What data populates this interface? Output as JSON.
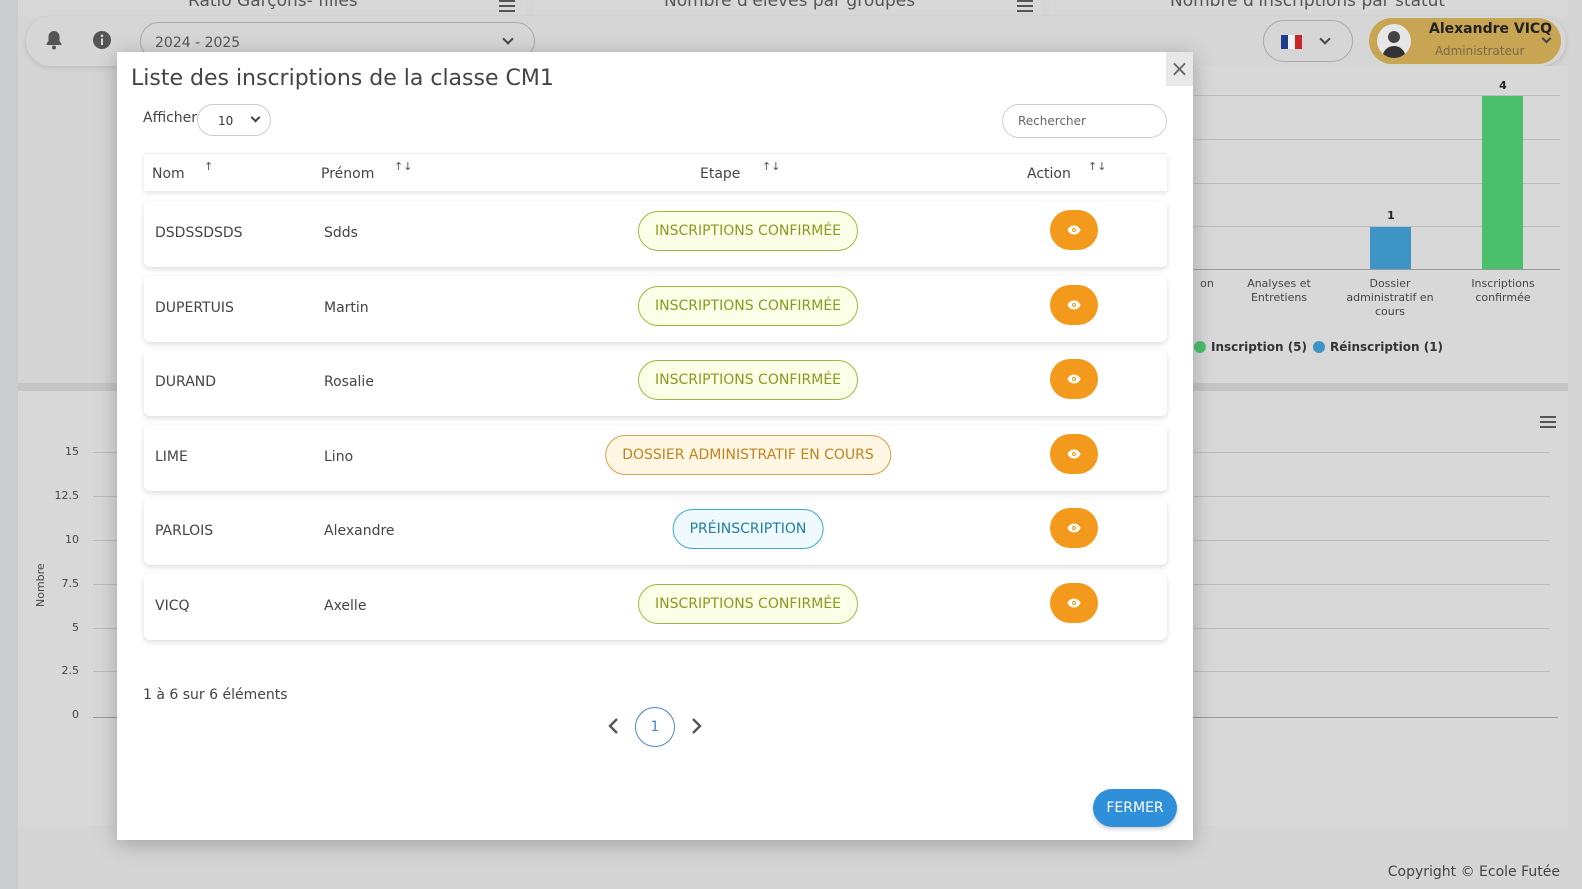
{
  "background": {
    "card_titles": [
      "Ratio Garçons- filles",
      "Nombre d'élèves par groupes",
      "Nombre d'inscriptions par statut"
    ],
    "year_select": "2024 - 2025",
    "user": {
      "name": "Alexandre VICQ",
      "role": "Administrateur"
    },
    "status_chart": {
      "categories": [
        "on",
        "Analyses et Entretiens",
        "Dossier administratif en cours",
        "Inscriptions confirmée"
      ],
      "bar_values": [
        "1",
        "4"
      ],
      "legend": [
        "Inscription (5)",
        "Réinscription (1)"
      ],
      "colors": {
        "inscription": "#4bc06c",
        "reinscription": "#3d95c6"
      }
    },
    "group_chart": {
      "ylabel": "Nombre",
      "yticks": [
        "15",
        "12.5",
        "10",
        "7.5",
        "5",
        "2.5",
        "0"
      ]
    },
    "copyright": "Copyright © Ecole Futée"
  },
  "modal": {
    "title": "Liste des inscriptions de la classe CM1",
    "show_label": "Afficher",
    "page_length": "10",
    "search_placeholder": "Rechercher",
    "columns": [
      "Nom",
      "Prénom",
      "Etape",
      "Action"
    ],
    "rows": [
      {
        "nom": "DSDSSDSDS",
        "prenom": "Sdds",
        "etape": "INSCRIPTIONS CONFIRMÉE",
        "status": "confirmed"
      },
      {
        "nom": "DUPERTUIS",
        "prenom": "Martin",
        "etape": "INSCRIPTIONS CONFIRMÉE",
        "status": "confirmed"
      },
      {
        "nom": "DURAND",
        "prenom": "Rosalie",
        "etape": "INSCRIPTIONS CONFIRMÉE",
        "status": "confirmed"
      },
      {
        "nom": "LIME",
        "prenom": "Lino",
        "etape": "DOSSIER ADMINISTRATIF EN COURS",
        "status": "dossier"
      },
      {
        "nom": "PARLOIS",
        "prenom": "Alexandre",
        "etape": "PRÉINSCRIPTION",
        "status": "pre"
      },
      {
        "nom": "VICQ",
        "prenom": "Axelle",
        "etape": "INSCRIPTIONS CONFIRMÉE",
        "status": "confirmed"
      }
    ],
    "info": "1 à 6 sur 6 éléments",
    "current_page": "1",
    "close_button": "FERMER",
    "colors": {
      "action": "#f39a1c",
      "primary": "#2f8fd8"
    }
  }
}
